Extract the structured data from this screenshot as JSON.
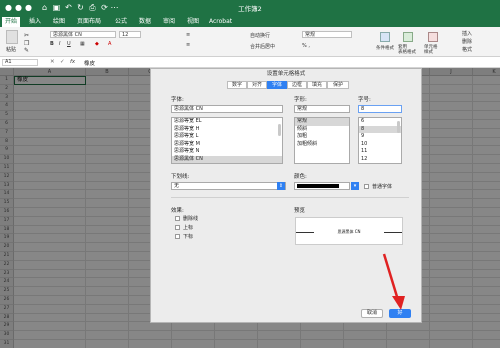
{
  "app": {
    "title": "工作簿2"
  },
  "menu_tabs": [
    "开始",
    "插入",
    "绘图",
    "页面布局",
    "公式",
    "数据",
    "审阅",
    "视图",
    "Acrobat"
  ],
  "ribbon": {
    "paste_label": "粘贴",
    "font_name": "思源黑体 CN",
    "font_size": "12",
    "wrap_text": "自动换行",
    "merge_center": "合并后居中",
    "number_format": "常规",
    "conditional_format": "条件格式",
    "format_as_table": "套用\n表格格式",
    "cell_styles": "单元格\n样式",
    "insert": "插入",
    "delete": "删除",
    "format": "格式"
  },
  "formula_bar": {
    "cell_ref": "A1",
    "fx": "fx",
    "value": "橡皮"
  },
  "sheet": {
    "columns": [
      "A",
      "B",
      "C",
      "D",
      "E",
      "F",
      "G",
      "H",
      "I",
      "J",
      "K"
    ],
    "rows": [
      "1",
      "2",
      "3",
      "4",
      "5",
      "6",
      "7",
      "8",
      "9",
      "10",
      "11",
      "12",
      "13",
      "14",
      "15",
      "16",
      "17",
      "18",
      "19",
      "20",
      "21",
      "22",
      "23",
      "24",
      "25",
      "26",
      "27",
      "28",
      "29",
      "30",
      "31"
    ],
    "a1_value": "橡皮"
  },
  "dialog": {
    "title": "设置单元格格式",
    "tabs": [
      "数字",
      "对齐",
      "字体",
      "边框",
      "填充",
      "保护"
    ],
    "active_tab": "字体",
    "font_label": "字体:",
    "font_value": "思源黑体 CN",
    "font_list": [
      "思源等宽 EL",
      "思源等宽 H",
      "思源等宽 L",
      "思源等宽 M",
      "思源等宽 N",
      "思源黑体 CN"
    ],
    "style_label": "字形:",
    "style_value": "常规",
    "style_list": [
      "常规",
      "倾斜",
      "加粗",
      "加粗倾斜"
    ],
    "size_label": "字号:",
    "size_value": "8",
    "size_list": [
      "6",
      "8",
      "9",
      "10",
      "11",
      "12"
    ],
    "underline_label": "下划线:",
    "underline_value": "无",
    "color_label": "颜色:",
    "normal_font_label": "普通字体",
    "effects_label": "效果:",
    "effects": [
      "删除线",
      "上标",
      "下标"
    ],
    "preview_label": "预览",
    "preview_text": "思源黑体 CN",
    "cancel_label": "取消",
    "ok_label": "好"
  }
}
